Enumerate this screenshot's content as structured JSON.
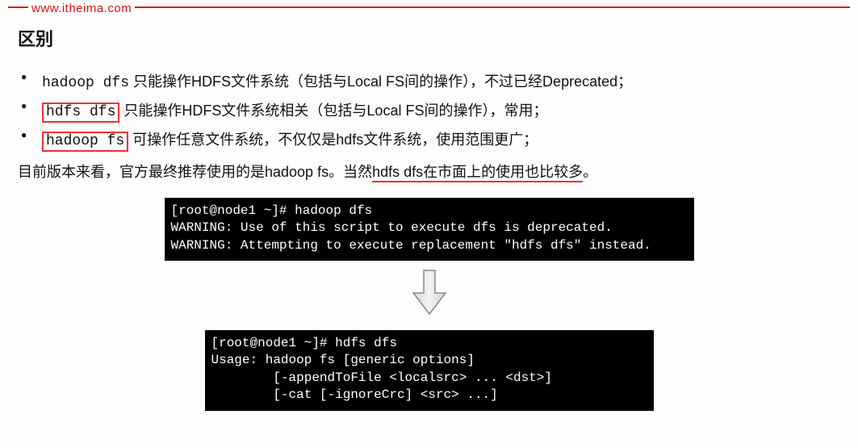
{
  "header": {
    "host": "www.itheima.com"
  },
  "section_title": "区别",
  "bullets": [
    {
      "cmd": "hadoop dfs",
      "desc": " 只能操作HDFS文件系统（包括与Local FS间的操作），不过已经Deprecated；"
    },
    {
      "cmd": "hdfs dfs",
      "desc": "   只能操作HDFS文件系统相关（包括与Local FS间的操作），常用；"
    },
    {
      "cmd": "hadoop fs",
      "desc": "  可操作任意文件系统，不仅仅是hdfs文件系统，使用范围更广；"
    }
  ],
  "summary": {
    "pre": "目前版本来看，官方最终推荐使用的是hadoop fs。当然",
    "mid": "hdfs dfs在市面上的使用也比较多",
    "post": "。"
  },
  "term1": {
    "prompt": "[root@node1 ~]# hadoop dfs",
    "l1": "WARNING: Use of this script to execute dfs is deprecated.",
    "l2": "WARNING: Attempting to execute replacement \"hdfs dfs\" instead."
  },
  "term2": {
    "prompt": "[root@node1 ~]# hdfs dfs",
    "l1": "Usage: hadoop fs [generic options]",
    "l2": "        [-appendToFile <localsrc> ... <dst>]",
    "l3": "        [-cat [-ignoreCrc] <src> ...]"
  }
}
